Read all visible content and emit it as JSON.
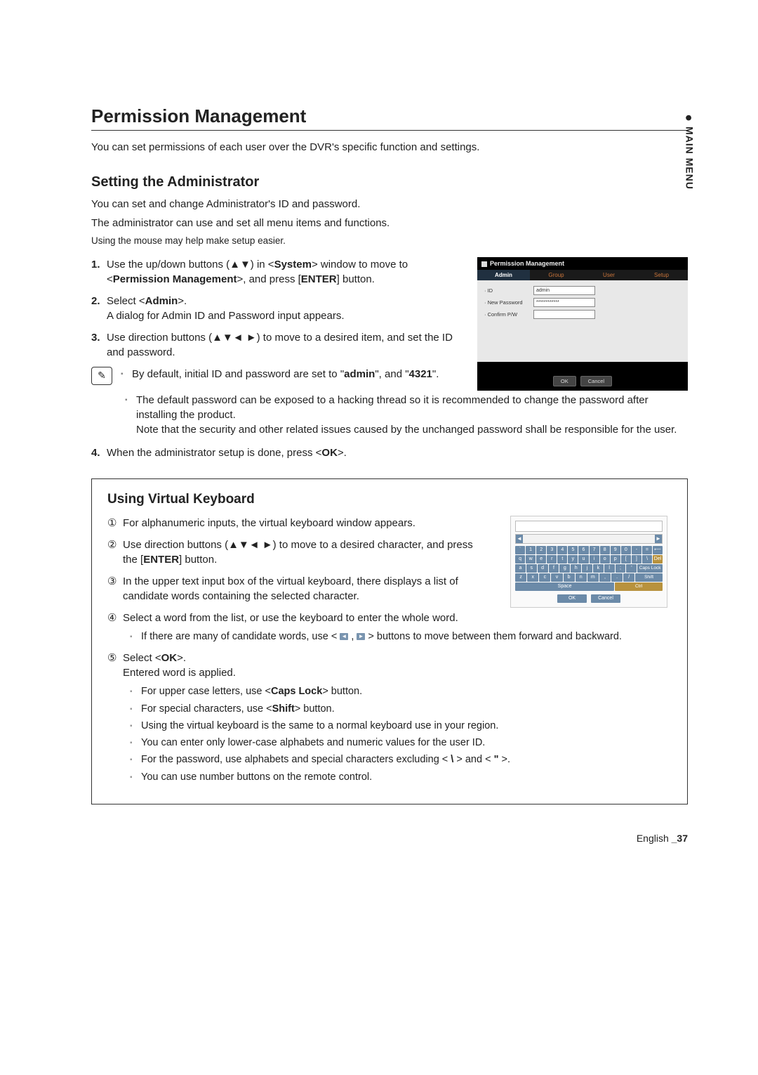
{
  "side_tab": {
    "label": "MAIN MENU"
  },
  "section": {
    "title": "Permission Management",
    "intro": "You can set permissions of each user over the DVR's specific function and settings."
  },
  "admin": {
    "heading": "Setting the Administrator",
    "p1": "You can set and change Administrator's ID and password.",
    "p2": "The administrator can use and set all menu items and functions.",
    "mouse_tip": "Using the mouse may help make setup easier.",
    "steps": {
      "s1a": "Use the up/down buttons (▲▼) in <",
      "s1b": "System",
      "s1c": "> window to move to <",
      "s1d": "Permission Management",
      "s1e": ">, and press [",
      "s1f": "ENTER",
      "s1g": "] button.",
      "s2a": "Select <",
      "s2b": "Admin",
      "s2c": ">.",
      "s2d": "A dialog for Admin ID and Password input appears.",
      "s3": "Use direction buttons (▲▼◄ ►) to move to a desired item, and set the ID and password.",
      "s4a": "When the administrator setup is done, press <",
      "s4b": "OK",
      "s4c": ">."
    },
    "notes": {
      "n1a": "By default, initial ID and password are set to \"",
      "n1b": "admin",
      "n1c": "\", and \"",
      "n1d": "4321",
      "n1e": "\".",
      "n2": "The default password can be exposed to a hacking thread so it is recommended to change the password after installing the product.",
      "n2b": "Note that the security and other related issues caused by the unchanged password shall be responsible for the user."
    }
  },
  "dvr": {
    "title": "Permission Management",
    "tabs": [
      "Admin",
      "Group",
      "User",
      "Setup"
    ],
    "fields": {
      "id_label": "· ID",
      "id_value": "admin",
      "pw_label": "· New Password",
      "pw_value": "************",
      "cpw_label": "· Confirm P/W",
      "cpw_value": ""
    },
    "ok": "OK",
    "cancel": "Cancel"
  },
  "vkb": {
    "heading": "Using Virtual Keyboard",
    "steps": {
      "s1": "For alphanumeric inputs, the virtual keyboard window appears.",
      "s2a": "Use direction buttons (▲▼◄ ►) to move to a desired character, and press the [",
      "s2b": "ENTER",
      "s2c": "] button.",
      "s3": "In the upper text input box of the virtual keyboard, there displays a list of candidate words containing the selected character.",
      "s4": "Select a word from the list, or use the keyboard to enter the whole word.",
      "s4_note_a": "If there are many of candidate words, use < ",
      "s4_note_b": " , ",
      "s4_note_c": " > buttons to move between them forward and backward.",
      "s5a": "Select <",
      "s5b": "OK",
      "s5c": ">.",
      "s5d": "Entered word is applied."
    },
    "tips": {
      "t1a": "For upper case letters, use <",
      "t1b": "Caps Lock",
      "t1c": "> button.",
      "t2a": "For special characters, use <",
      "t2b": "Shift",
      "t2c": "> button.",
      "t3": "Using the virtual keyboard is the same to a normal keyboard use in your region.",
      "t4": "You can enter only lower-case alphabets and numeric values for the user ID.",
      "t5a": "For the password, use alphabets and special characters excluding < ",
      "t5b": "\\",
      "t5c": " > and < ",
      "t5d": "\"",
      "t5e": " >.",
      "t6": "You can use number buttons on the remote control."
    },
    "keys": {
      "row1": [
        "`",
        "1",
        "2",
        "3",
        "4",
        "5",
        "6",
        "7",
        "8",
        "9",
        "0",
        "-",
        "=",
        "⟵"
      ],
      "row2": [
        "q",
        "w",
        "e",
        "r",
        "t",
        "y",
        "u",
        "i",
        "o",
        "p",
        "[",
        "]",
        "\\"
      ],
      "row3": [
        "a",
        "s",
        "d",
        "f",
        "g",
        "h",
        "j",
        "k",
        "l",
        ";",
        "'"
      ],
      "row4": [
        "z",
        "x",
        "c",
        "v",
        "b",
        "n",
        "m",
        ",",
        ".",
        "/"
      ],
      "caps": "Caps Lock",
      "shift": "Shift",
      "del": "Del",
      "space": "Space",
      "ok": "OK",
      "cancel": "Cancel"
    }
  },
  "footer": {
    "lang": "English",
    "page": "_37"
  }
}
